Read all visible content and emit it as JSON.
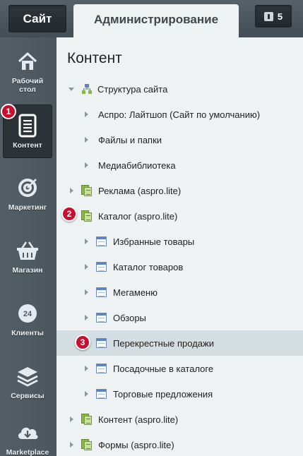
{
  "topbar": {
    "site_tab": "Сайт",
    "admin_tab": "Администрирование",
    "notifications_count": "5"
  },
  "sidebar": {
    "items": [
      {
        "label": "Рабочий стол",
        "icon": "home-icon"
      },
      {
        "label": "Контент",
        "icon": "document-icon",
        "active": true
      },
      {
        "label": "Маркетинг",
        "icon": "target-icon"
      },
      {
        "label": "Магазин",
        "icon": "basket-icon"
      },
      {
        "label": "Клиенты",
        "icon": "clients-24-icon"
      },
      {
        "label": "Сервисы",
        "icon": "layers-icon"
      },
      {
        "label": "Marketplace",
        "icon": "cloud-download-icon"
      }
    ]
  },
  "badges": {
    "b1": "1",
    "b2": "2",
    "b3": "3"
  },
  "main": {
    "title": "Контент",
    "tree": [
      {
        "label": "Структура сайта",
        "level": 0,
        "expanded": true,
        "icon": "site-structure-icon"
      },
      {
        "label": "Аспро: Лайтшоп (Сайт по умолчанию)",
        "level": 1,
        "icon": ""
      },
      {
        "label": "Файлы и папки",
        "level": 1,
        "icon": ""
      },
      {
        "label": "Медиабиблиотека",
        "level": 1,
        "icon": ""
      },
      {
        "label": "Реклама (aspro.lite)",
        "level": 0,
        "icon": "iblock-type-icon"
      },
      {
        "label": "Каталог (aspro.lite)",
        "level": 0,
        "expanded": true,
        "icon": "iblock-type-icon"
      },
      {
        "label": "Избранные товары",
        "level": 1,
        "icon": "iblock-icon"
      },
      {
        "label": "Каталог товаров",
        "level": 1,
        "icon": "iblock-icon"
      },
      {
        "label": "Мегаменю",
        "level": 1,
        "icon": "iblock-icon"
      },
      {
        "label": "Обзоры",
        "level": 1,
        "icon": "iblock-icon"
      },
      {
        "label": "Перекрестные продажи",
        "level": 1,
        "icon": "iblock-icon",
        "selected": true
      },
      {
        "label": "Посадочные в каталоге",
        "level": 1,
        "icon": "iblock-icon"
      },
      {
        "label": "Торговые предложения",
        "level": 1,
        "icon": "iblock-icon"
      },
      {
        "label": "Контент (aspro.lite)",
        "level": 0,
        "icon": "iblock-type-icon"
      },
      {
        "label": "Формы (aspro.lite)",
        "level": 0,
        "icon": "iblock-type-icon"
      }
    ]
  },
  "colors": {
    "badge": "#c8102e",
    "sidebar_bg": "#4f5a61",
    "panel_bg": "#eef2f3",
    "selected_row": "#d4dde1"
  }
}
